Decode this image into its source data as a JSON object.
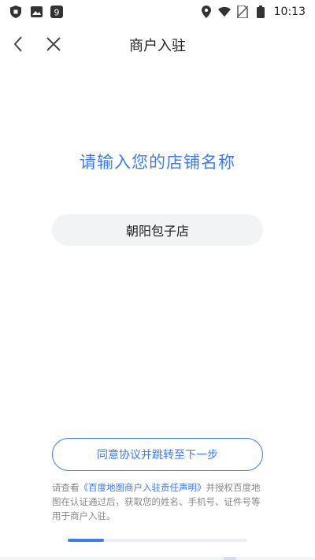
{
  "status_bar": {
    "time": "10:13",
    "left_icons": [
      "shield-icon",
      "image-icon",
      "app-badge-icon"
    ],
    "right_icons": [
      "location-icon",
      "wifi-icon",
      "no-sim-icon",
      "battery-icon"
    ],
    "app_badge_text": "9"
  },
  "nav": {
    "title": "商户入驻",
    "back_icon": "chevron-left-icon",
    "close_icon": "close-icon"
  },
  "form": {
    "heading": "请输入您的店铺名称",
    "store_name_value": "朝阳包子店"
  },
  "agree_button_label": "同意协议并跳转至下一步",
  "notice": {
    "prefix": "请查看",
    "link_text": "《百度地图商户入驻责任声明》",
    "suffix": "并授权百度地图在认证通过后，获取您的姓名、手机号、证件号等用于商户入驻。"
  },
  "progress": {
    "fraction": 0.2
  },
  "colors": {
    "accent": "#3d7cf2",
    "field_bg": "#f2f3f5",
    "notice_text": "#888888"
  }
}
